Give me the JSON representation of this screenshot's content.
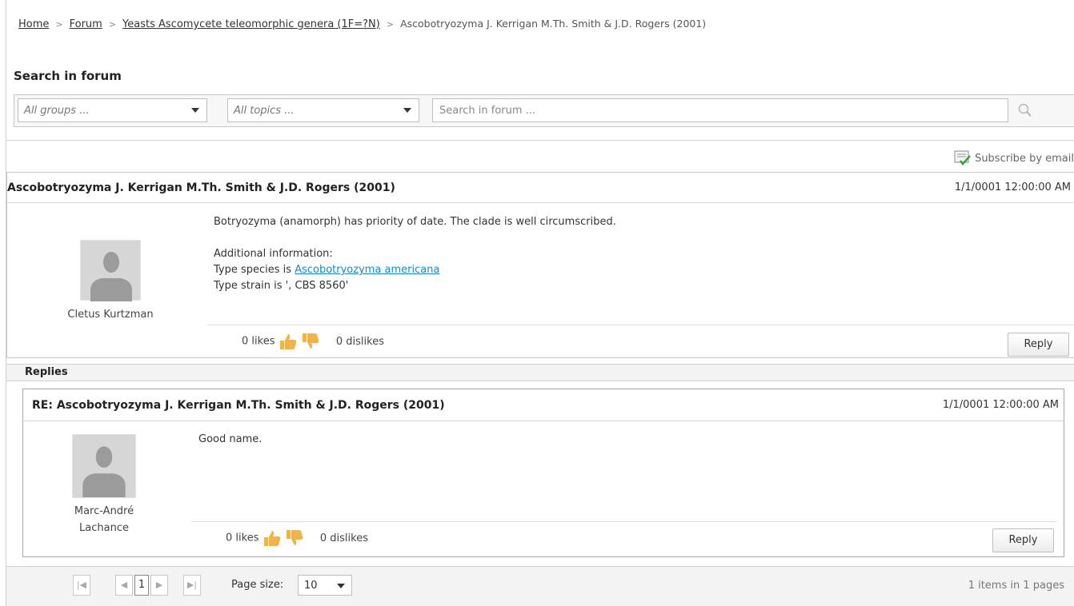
{
  "breadcrumb": {
    "home": "Home",
    "forum": "Forum",
    "group": "Yeasts Ascomycete teleomorphic genera (1F=?N)",
    "current": "Ascobotryozyma J. Kerrigan M.Th. Smith & J.D. Rogers (2001)",
    "separator": ">"
  },
  "search": {
    "title": "Search in forum",
    "groups_placeholder": "All groups ...",
    "topics_placeholder": "All topics ...",
    "input_placeholder": "Search in forum ..."
  },
  "subscribe": {
    "label": "Subscribe by email"
  },
  "post": {
    "title": "Ascobotryozyma J. Kerrigan M.Th. Smith & J.D. Rogers (2001)",
    "date": "1/1/0001 12:00:00 AM",
    "author": "Cletus Kurtzman",
    "line1": "Botryozyma (anamorph) has priority of date. The clade is well circumscribed.",
    "line2": "Additional information:",
    "line3_prefix": "Type species is ",
    "line3_link": "Ascobotryozyma americana",
    "line4": "Type strain is ', CBS 8560'",
    "likes": "0 likes",
    "dislikes": "0 dislikes",
    "reply": "Reply"
  },
  "replies": {
    "label": "Replies",
    "items": [
      {
        "title": "RE: Ascobotryozyma J. Kerrigan M.Th. Smith & J.D. Rogers (2001)",
        "date": "1/1/0001 12:00:00 AM",
        "author_line1": "Marc-André",
        "author_line2": "Lachance",
        "text": "Good name.",
        "likes": "0 likes",
        "dislikes": "0 dislikes",
        "reply": "Reply"
      }
    ]
  },
  "pager": {
    "first": "|◀",
    "prev": "◀",
    "current_page": "1",
    "next": "▶",
    "last": "▶|",
    "page_size_label": "Page size:",
    "page_size_value": "10",
    "summary": "1 items in 1 pages"
  },
  "colors": {
    "link": "#1a88c9",
    "thumb": "#f0b24a",
    "avatar_bg": "#d6d6d6",
    "avatar_fg": "#9b9b9b"
  },
  "icons": {
    "search": "search-icon",
    "subscribe": "email-subscribe-icon",
    "like": "thumbs-up-icon",
    "dislike": "thumbs-down-icon",
    "avatar": "user-avatar-icon"
  }
}
